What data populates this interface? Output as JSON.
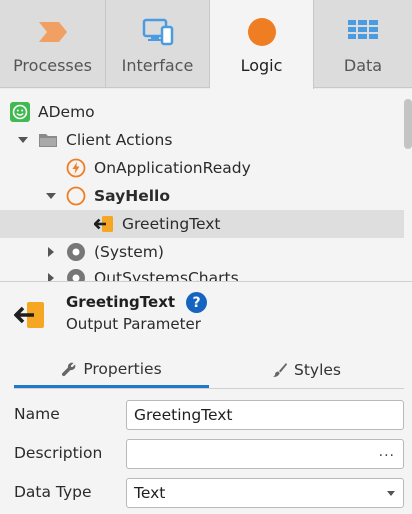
{
  "tabs": [
    {
      "label": "Processes",
      "icon": "processes-chevron-icon",
      "color": "#f08a3c"
    },
    {
      "label": "Interface",
      "icon": "interface-devices-icon",
      "color": "#3b8fd8"
    },
    {
      "label": "Logic",
      "icon": "logic-circle-icon",
      "color": "#ef7d22",
      "active": true
    },
    {
      "label": "Data",
      "icon": "data-grid-icon",
      "color": "#3b8fd8"
    }
  ],
  "tree": {
    "items": [
      {
        "label": "ADemo",
        "icon": "app-smiley-icon"
      },
      {
        "label": "Client Actions",
        "icon": "folder-icon",
        "expanded": true
      },
      {
        "label": "OnApplicationReady",
        "icon": "lightning-event-icon"
      },
      {
        "label": "SayHello",
        "icon": "action-circle-icon",
        "expanded": true,
        "bold": true
      },
      {
        "label": "GreetingText",
        "icon": "output-parameter-icon",
        "selected": true
      },
      {
        "label": "(System)",
        "icon": "module-gear-icon",
        "expanded": false
      },
      {
        "label": "OutSystemsCharts",
        "icon": "module-gear-icon",
        "expanded": false
      }
    ]
  },
  "details": {
    "name": "GreetingText",
    "help": "?",
    "type": "Output Parameter",
    "subtabs": [
      {
        "label": "Properties",
        "icon": "wrench-icon",
        "active": true
      },
      {
        "label": "Styles",
        "icon": "brush-icon",
        "active": false
      }
    ],
    "properties": [
      {
        "label": "Name",
        "value": "GreetingText",
        "control": "text"
      },
      {
        "label": "Description",
        "value": "",
        "control": "ellipsis",
        "button": "..."
      },
      {
        "label": "Data Type",
        "value": "Text",
        "control": "dropdown"
      }
    ]
  },
  "colors": {
    "accent": "#1f78c8",
    "logic_orange": "#ef7d22",
    "output_param_orange": "#f5a623",
    "help_blue": "#1565c0",
    "app_green": "#3fb950"
  }
}
